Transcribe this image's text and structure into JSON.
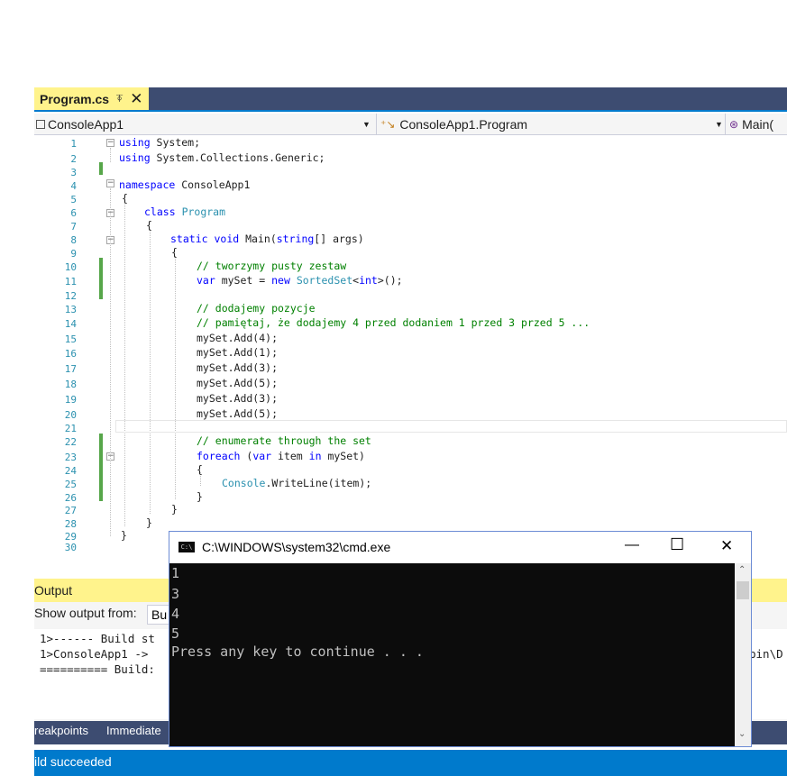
{
  "document_tab": {
    "filename": "Program.cs",
    "pin": "⍕",
    "close": "✕"
  },
  "nav": {
    "project": "ConsoleApp1",
    "class": "ConsoleApp1.Program",
    "member": "Main("
  },
  "editor": {
    "line_numbers": [
      "1",
      "2",
      "3",
      "4",
      "5",
      "6",
      "7",
      "8",
      "9",
      "10",
      "11",
      "12",
      "13",
      "14",
      "15",
      "16",
      "17",
      "18",
      "19",
      "20",
      "21",
      "22",
      "23",
      "24",
      "25",
      "26",
      "27",
      "28",
      "29",
      "30"
    ],
    "code": {
      "l1_kw": "using",
      "l1_rest": " System;",
      "l2_kw": "using",
      "l2_rest": " System.Collections.Generic;",
      "l4_kw": "namespace",
      "l4_rest": " ConsoleApp1",
      "l5": "{",
      "l6_kw": "class",
      "l6_type": "Program",
      "l7": "{",
      "l8_kw1": "static",
      "l8_kw2": "void",
      "l8_mid": "Main(",
      "l8_kw3": "string",
      "l8_rest": "[] args)",
      "l9": "{",
      "l10": "// tworzymy pusty zestaw",
      "l11_kw": "var",
      "l11_mid": " mySet = ",
      "l11_kw2": "new",
      "l11_type": "SortedSet",
      "l11_lt": "<",
      "l11_kw3": "int",
      "l11_rest": ">();",
      "l13": "// dodajemy pozycje",
      "l14": "// pamiętaj, że dodajemy 4 przed dodaniem 1 przed 3 przed 5 ...",
      "l15": "mySet.Add(4);",
      "l16": "mySet.Add(1);",
      "l17": "mySet.Add(3);",
      "l18": "mySet.Add(5);",
      "l19": "mySet.Add(3);",
      "l20": "mySet.Add(5);",
      "l22": "// enumerate through the set",
      "l23_kw": "foreach",
      "l23_p1": " (",
      "l23_kw2": "var",
      "l23_mid": " item ",
      "l23_kw3": "in",
      "l23_rest": " mySet)",
      "l24": "{",
      "l25_type": "Console",
      "l25_rest": ".WriteLine(item);",
      "l26": "}",
      "l27": "}",
      "l28": "}",
      "l29": "}"
    }
  },
  "output": {
    "title": "Output",
    "show_from_label": "Show output from:",
    "source_value": "Bu",
    "lines": [
      "1>------ Build st",
      "1>ConsoleApp1 ->",
      "========== Build:"
    ],
    "right_fragment": "bin\\D"
  },
  "bottom_tabs": {
    "breakpoints": "reakpoints",
    "immediate": "Immediate"
  },
  "status": {
    "text": "ild succeeded"
  },
  "cmd": {
    "title": "C:\\WINDOWS\\system32\\cmd.exe",
    "icon_text": "C:\\",
    "minimize": "—",
    "maximize": "☐",
    "close": "✕",
    "output_lines": [
      "1",
      "3",
      "4",
      "5",
      "Press any key to continue . . ."
    ]
  },
  "colors": {
    "vs_accent": "#007acc",
    "tab_active": "#fff38c",
    "comment": "#008000",
    "keyword": "#0000ff",
    "type": "#2b91af"
  }
}
